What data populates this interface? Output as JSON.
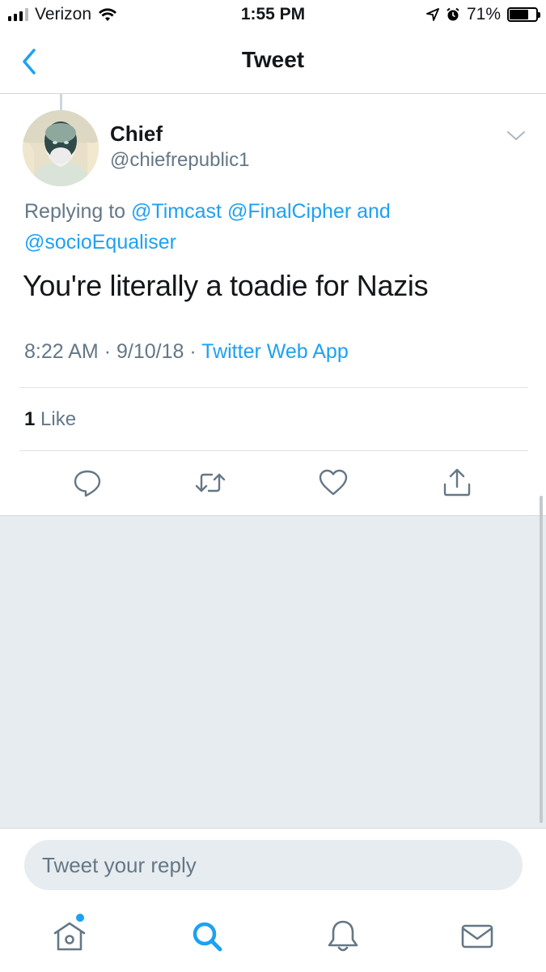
{
  "status_bar": {
    "carrier": "Verizon",
    "time": "1:55 PM",
    "battery_percent": "71%",
    "battery_level": 0.71,
    "icons": [
      "signal-icon",
      "wifi-icon",
      "location-icon",
      "alarm-icon",
      "battery-icon"
    ]
  },
  "header": {
    "title": "Tweet",
    "back_icon": "back-chevron-icon"
  },
  "tweet": {
    "display_name": "Chief",
    "handle": "@chiefrepublic1",
    "replying_prefix": "Replying to",
    "mention_1": "@Timcast",
    "mention_2": "@FinalCipher",
    "mention_joiner": "and",
    "mention_3": "@socioEqualiser",
    "text": "You're literally a toadie for Nazis",
    "time": "8:22 AM",
    "date": "9/10/18",
    "separator": "·",
    "source": "Twitter Web App",
    "likes_count": "1",
    "likes_label": "Like"
  },
  "actions": [
    "reply-icon",
    "retweet-icon",
    "like-icon",
    "share-icon"
  ],
  "composer": {
    "placeholder": "Tweet your reply"
  },
  "tabbar": {
    "items": [
      "home-icon",
      "search-icon",
      "notifications-icon",
      "messages-icon"
    ],
    "active": "search-icon"
  },
  "colors": {
    "accent": "#1da1f2",
    "secondary_text": "#657786",
    "primary_text": "#14171a",
    "background_gray": "#e6ecf0"
  }
}
